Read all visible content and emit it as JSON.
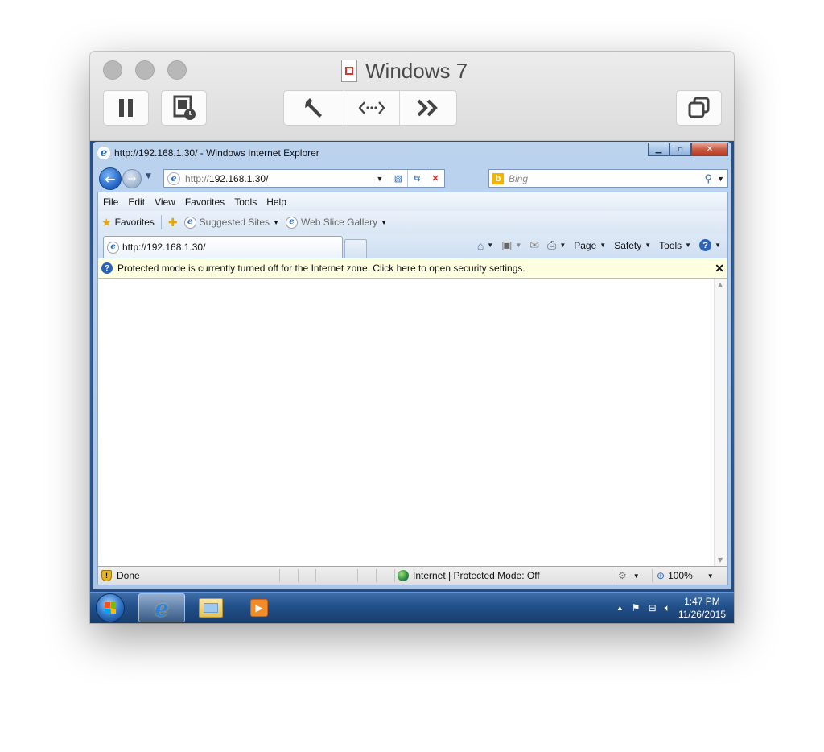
{
  "vm": {
    "title": "Windows 7",
    "toolbar_icons": [
      "pause-icon",
      "snapshot-icon",
      "wrench-icon",
      "network-icon",
      "fast-forward-icon",
      "window-icon"
    ]
  },
  "ie": {
    "window_title": "http://192.168.1.30/ - Windows Internet Explorer",
    "address": {
      "protocol": "http://",
      "host": "192.168.1.30/"
    },
    "search_placeholder": "Bing",
    "menu": [
      "File",
      "Edit",
      "View",
      "Favorites",
      "Tools",
      "Help"
    ],
    "favorites": {
      "label": "Favorites",
      "suggested_sites": "Suggested Sites",
      "web_slice_gallery": "Web Slice Gallery"
    },
    "tab_label": "http://192.168.1.30/",
    "commands": {
      "page": "Page",
      "safety": "Safety",
      "tools": "Tools"
    },
    "infobar_text": "Protected mode is currently turned off for the Internet zone.  Click here to open security settings.",
    "status": {
      "text": "Done",
      "zone": "Internet | Protected Mode: Off",
      "zoom": "100%"
    }
  },
  "taskbar": {
    "time": "1:47 PM",
    "date": "11/26/2015"
  },
  "colors": {
    "desktop": "#2a66b6",
    "infobar": "#ffffe1",
    "close_button": "#c75a43"
  }
}
